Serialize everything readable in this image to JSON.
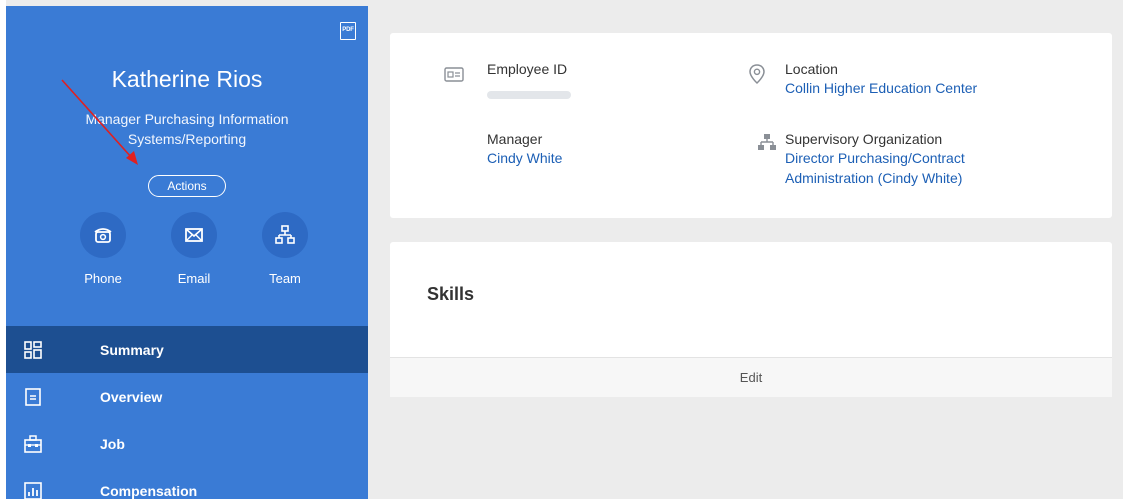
{
  "profile": {
    "name": "Katherine Rios",
    "title": "Manager Purchasing Information Systems/Reporting",
    "actions_label": "Actions",
    "pdf_label": "PDF"
  },
  "quick_actions": [
    {
      "label": "Phone",
      "icon": "phone-icon"
    },
    {
      "label": "Email",
      "icon": "email-icon"
    },
    {
      "label": "Team",
      "icon": "team-icon"
    }
  ],
  "nav": {
    "items": [
      {
        "label": "Summary",
        "icon": "summary-icon",
        "active": true
      },
      {
        "label": "Overview",
        "icon": "overview-icon",
        "active": false
      },
      {
        "label": "Job",
        "icon": "job-icon",
        "active": false
      },
      {
        "label": "Compensation",
        "icon": "compensation-icon",
        "active": false
      }
    ]
  },
  "info_card": {
    "employee_id_label": "Employee ID",
    "location_label": "Location",
    "location_value": "Collin Higher Education Center",
    "manager_label": "Manager",
    "manager_value": "Cindy White",
    "sup_org_label": "Supervisory Organization",
    "sup_org_value": "Director Purchasing/Contract Administration (Cindy White)"
  },
  "skills_card": {
    "title": "Skills",
    "edit_label": "Edit"
  },
  "colors": {
    "sidebar": "#3a7bd5",
    "sidebar_active": "#1d4f91",
    "link": "#1c5fb5",
    "annotation_arrow": "#e02020"
  }
}
